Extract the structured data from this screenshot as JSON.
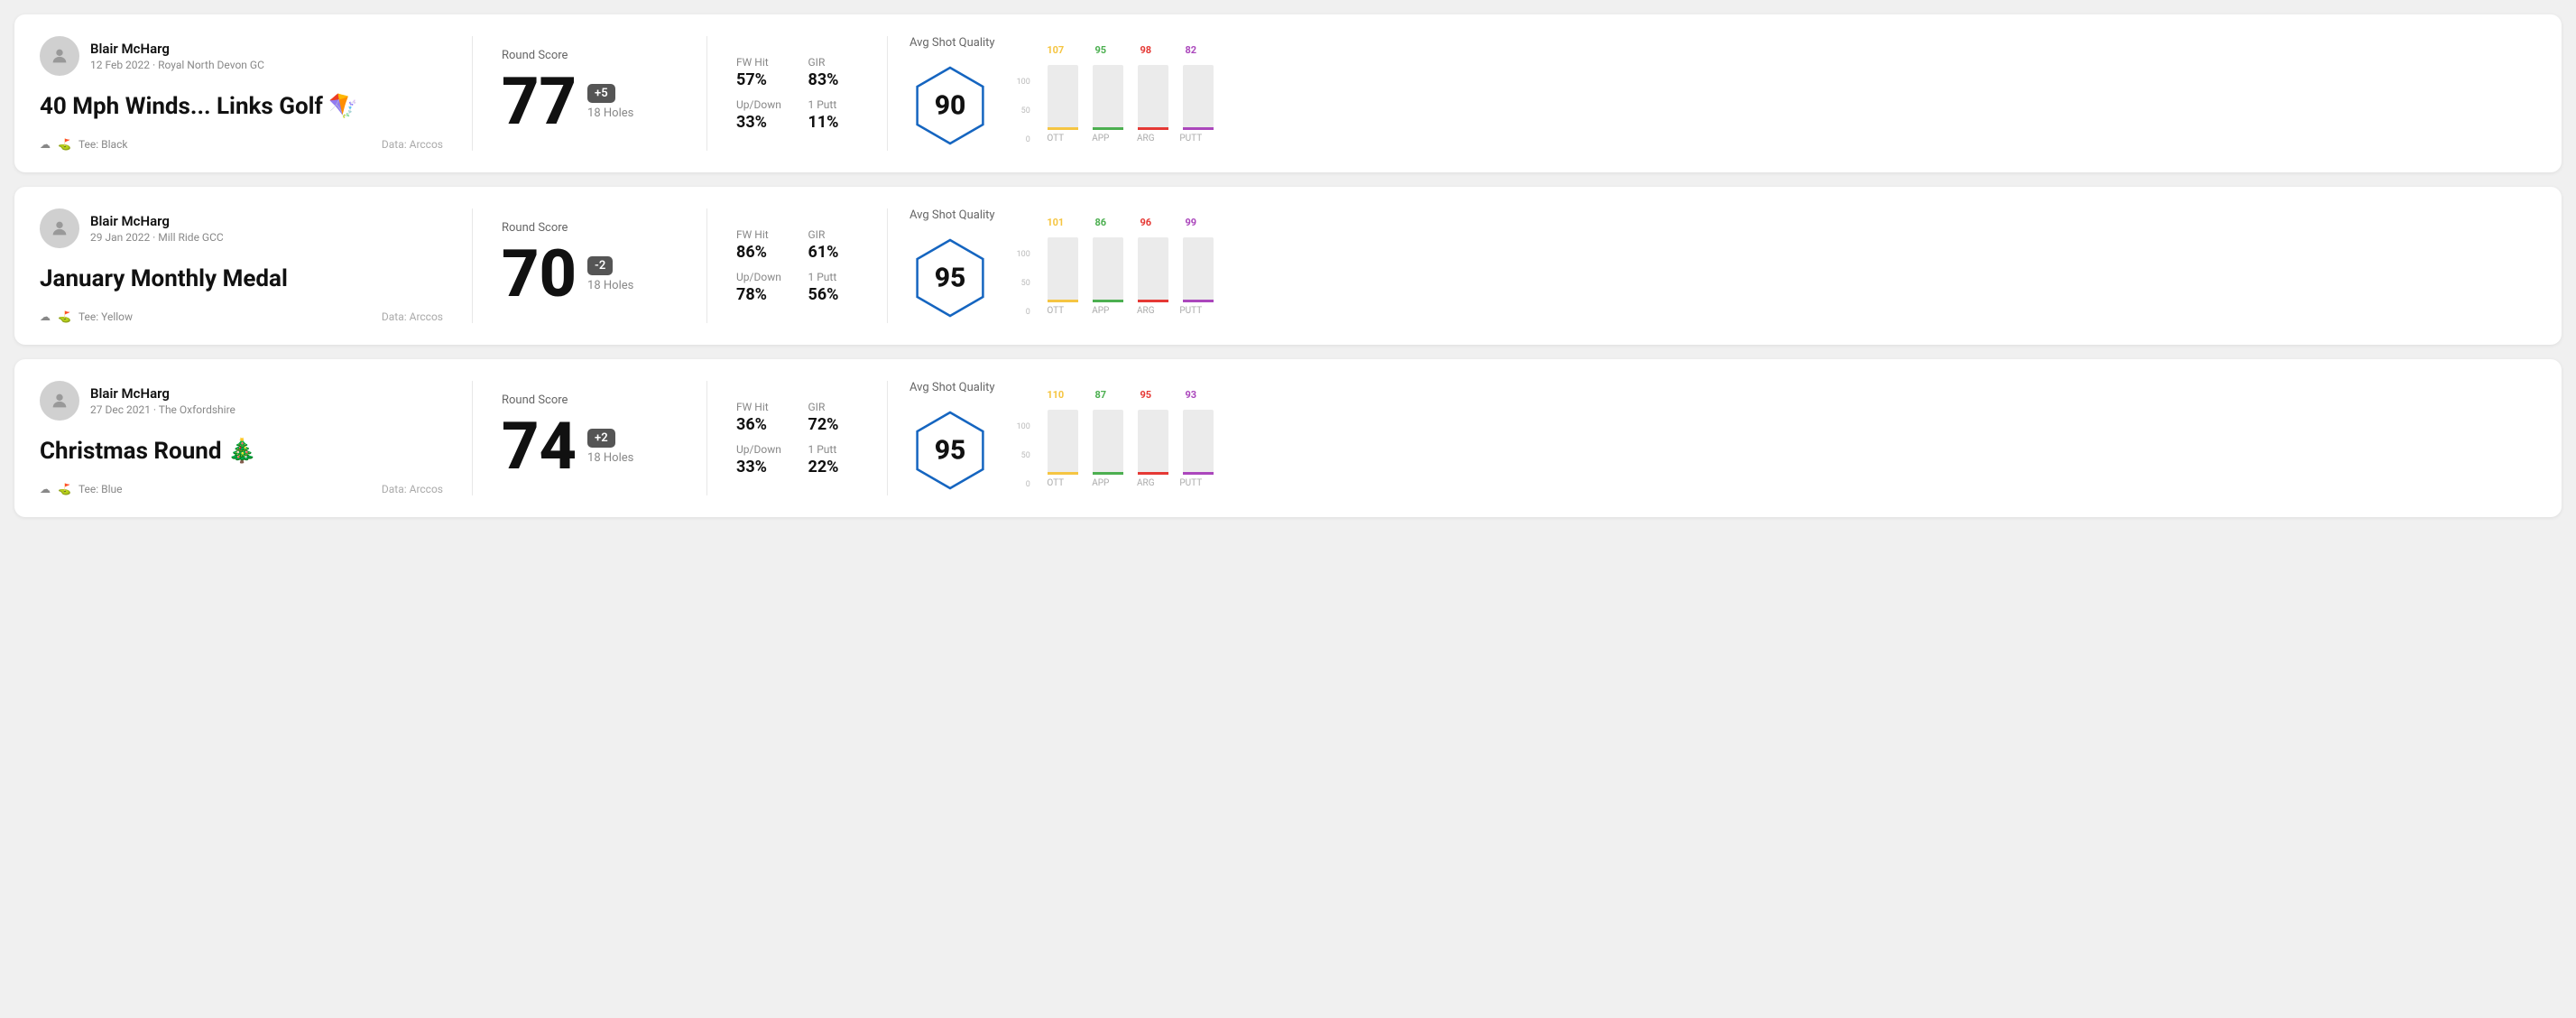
{
  "rounds": [
    {
      "id": "round1",
      "userName": "Blair McHarg",
      "userMeta": "12 Feb 2022 · Royal North Devon GC",
      "roundTitle": "40 Mph Winds... Links Golf 🪁",
      "tee": "Tee: Black",
      "dataSource": "Data: Arccos",
      "scoreSectionLabel": "Round Score",
      "bigScore": "77",
      "badgeText": "+5",
      "badgeType": "over",
      "holesLabel": "18 Holes",
      "fwHitLabel": "FW Hit",
      "fwHitValue": "57%",
      "girLabel": "GIR",
      "girValue": "83%",
      "upDownLabel": "Up/Down",
      "upDownValue": "33%",
      "onePuttLabel": "1 Putt",
      "onePuttValue": "11%",
      "avgShotQualityLabel": "Avg Shot Quality",
      "hexScore": "90",
      "bars": [
        {
          "label": "OTT",
          "value": 107,
          "color": "#f5c542",
          "maxH": 72
        },
        {
          "label": "APP",
          "value": 95,
          "color": "#4caf50",
          "maxH": 72
        },
        {
          "label": "ARG",
          "value": 98,
          "color": "#e53935",
          "maxH": 72
        },
        {
          "label": "PUTT",
          "value": 82,
          "color": "#ab47bc",
          "maxH": 72
        }
      ],
      "hexColor": "#1565c0"
    },
    {
      "id": "round2",
      "userName": "Blair McHarg",
      "userMeta": "29 Jan 2022 · Mill Ride GCC",
      "roundTitle": "January Monthly Medal",
      "tee": "Tee: Yellow",
      "dataSource": "Data: Arccos",
      "scoreSectionLabel": "Round Score",
      "bigScore": "70",
      "badgeText": "-2",
      "badgeType": "under",
      "holesLabel": "18 Holes",
      "fwHitLabel": "FW Hit",
      "fwHitValue": "86%",
      "girLabel": "GIR",
      "girValue": "61%",
      "upDownLabel": "Up/Down",
      "upDownValue": "78%",
      "onePuttLabel": "1 Putt",
      "onePuttValue": "56%",
      "avgShotQualityLabel": "Avg Shot Quality",
      "hexScore": "95",
      "bars": [
        {
          "label": "OTT",
          "value": 101,
          "color": "#f5c542",
          "maxH": 72
        },
        {
          "label": "APP",
          "value": 86,
          "color": "#4caf50",
          "maxH": 72
        },
        {
          "label": "ARG",
          "value": 96,
          "color": "#e53935",
          "maxH": 72
        },
        {
          "label": "PUTT",
          "value": 99,
          "color": "#ab47bc",
          "maxH": 72
        }
      ],
      "hexColor": "#1565c0"
    },
    {
      "id": "round3",
      "userName": "Blair McHarg",
      "userMeta": "27 Dec 2021 · The Oxfordshire",
      "roundTitle": "Christmas Round 🎄",
      "tee": "Tee: Blue",
      "dataSource": "Data: Arccos",
      "scoreSectionLabel": "Round Score",
      "bigScore": "74",
      "badgeText": "+2",
      "badgeType": "over",
      "holesLabel": "18 Holes",
      "fwHitLabel": "FW Hit",
      "fwHitValue": "36%",
      "girLabel": "GIR",
      "girValue": "72%",
      "upDownLabel": "Up/Down",
      "upDownValue": "33%",
      "onePuttLabel": "1 Putt",
      "onePuttValue": "22%",
      "avgShotQualityLabel": "Avg Shot Quality",
      "hexScore": "95",
      "bars": [
        {
          "label": "OTT",
          "value": 110,
          "color": "#f5c542",
          "maxH": 72
        },
        {
          "label": "APP",
          "value": 87,
          "color": "#4caf50",
          "maxH": 72
        },
        {
          "label": "ARG",
          "value": 95,
          "color": "#e53935",
          "maxH": 72
        },
        {
          "label": "PUTT",
          "value": 93,
          "color": "#ab47bc",
          "maxH": 72
        }
      ],
      "hexColor": "#1565c0"
    }
  ],
  "yAxisLabels": [
    "100",
    "50",
    "0"
  ]
}
